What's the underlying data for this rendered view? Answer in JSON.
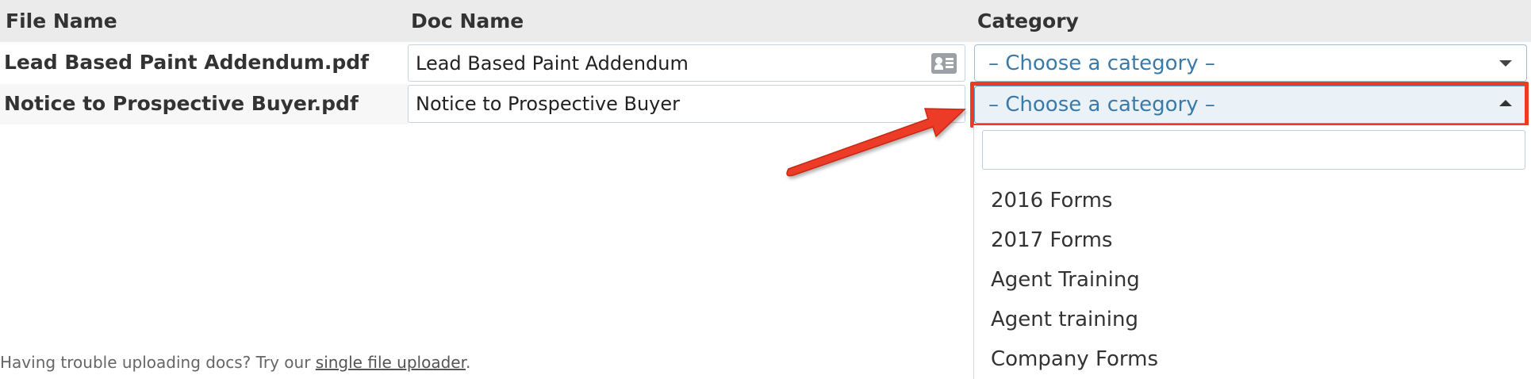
{
  "table": {
    "headers": {
      "file_name": "File Name",
      "doc_name": "Doc Name",
      "category": "Category"
    },
    "rows": [
      {
        "file_name": "Lead Based Paint Addendum.pdf",
        "doc_name": "Lead Based Paint Addendum",
        "category": "– Choose a category –"
      },
      {
        "file_name": "Notice to Prospective Buyer.pdf",
        "doc_name": "Notice to Prospective Buyer",
        "category": "– Choose a category –"
      }
    ]
  },
  "dropdown": {
    "search_value": "",
    "options": [
      "2016 Forms",
      "2017 Forms",
      "Agent Training",
      "Agent training",
      "Company Forms"
    ]
  },
  "footer": {
    "text": "Having trouble uploading docs? Try our ",
    "link": "single file uploader",
    "suffix": "."
  },
  "colors": {
    "annotation": "#ec3a25",
    "select_text": "#3a7aa8",
    "header_bg": "#ebebeb"
  },
  "icons": {
    "doc_name_icon": "contact-card-icon",
    "select_caret": "chevron-down-icon",
    "open_caret": "chevron-up-icon",
    "annotation": "arrow-pointer"
  }
}
